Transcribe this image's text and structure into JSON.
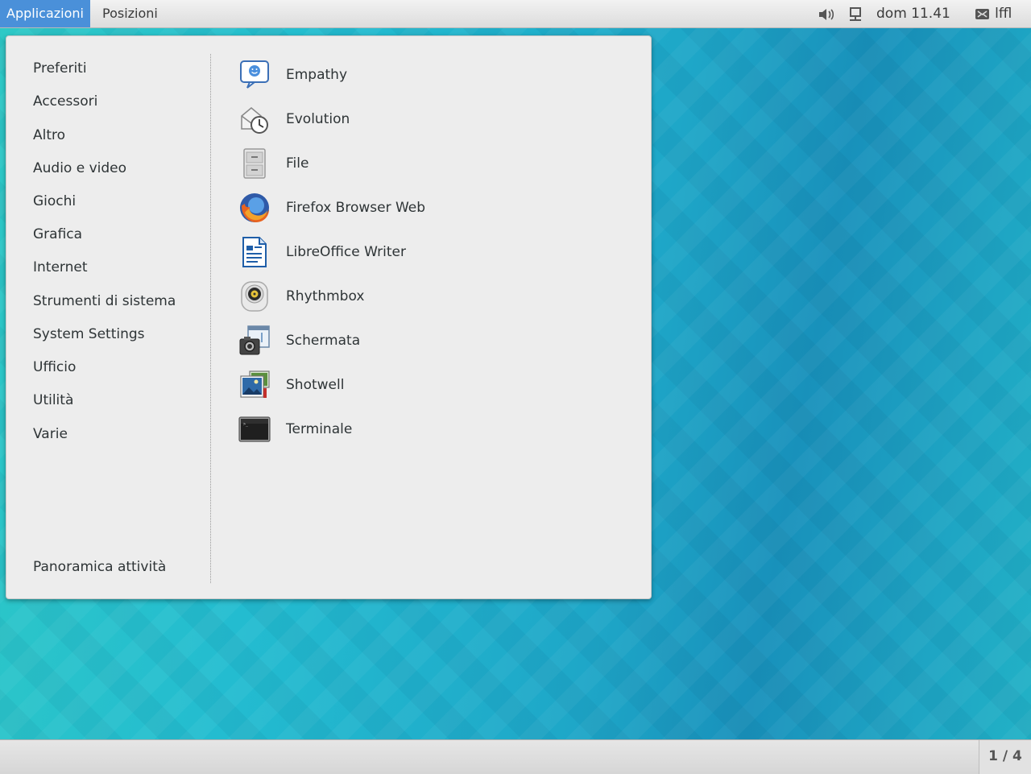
{
  "topbar": {
    "applications": "Applicazioni",
    "places": "Posizioni",
    "clock": "dom 11.41",
    "user": "lffl",
    "volume_icon": "speaker-icon",
    "network_icon": "network-wired-icon",
    "user_icon": "mail-icon"
  },
  "menu": {
    "categories": [
      "Preferiti",
      "Accessori",
      "Altro",
      "Audio e video",
      "Giochi",
      "Grafica",
      "Internet",
      "Strumenti di sistema",
      "System Settings",
      "Ufficio",
      "Utilità",
      "Varie"
    ],
    "overview": "Panoramica attività",
    "apps": [
      {
        "label": "Empathy",
        "icon": "chat-icon"
      },
      {
        "label": "Evolution",
        "icon": "mail-clock-icon"
      },
      {
        "label": "File",
        "icon": "file-cabinet-icon"
      },
      {
        "label": "Firefox Browser Web",
        "icon": "firefox-icon"
      },
      {
        "label": "LibreOffice Writer",
        "icon": "document-icon"
      },
      {
        "label": "Rhythmbox",
        "icon": "speaker-music-icon"
      },
      {
        "label": "Schermata",
        "icon": "camera-screenshot-icon"
      },
      {
        "label": "Shotwell",
        "icon": "photos-icon"
      },
      {
        "label": "Terminale",
        "icon": "terminal-icon"
      }
    ]
  },
  "workspace": "1 / 4",
  "colors": {
    "accent": "#4a90d9",
    "desktop": "#22b6cc"
  }
}
